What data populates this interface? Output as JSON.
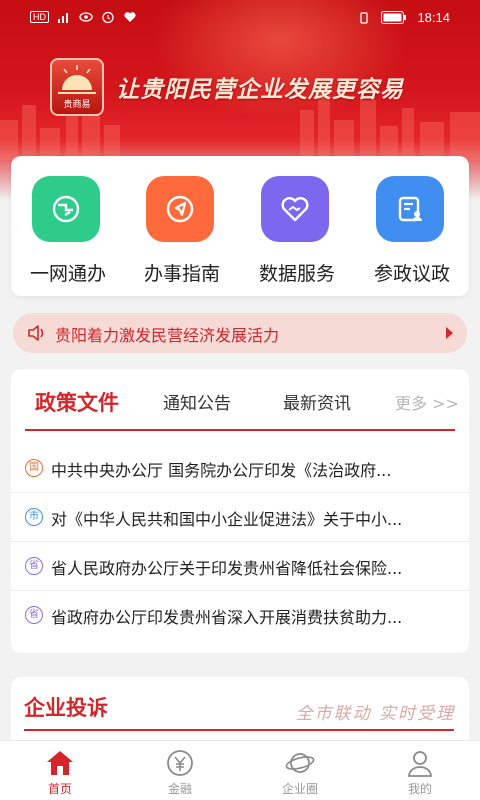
{
  "status_bar": {
    "time": "18:14",
    "left_label": "HD"
  },
  "brand": {
    "logo_text": "贵商易",
    "slogan": "让贵阳民营企业发展更容易"
  },
  "services": [
    {
      "label": "一网通办",
      "icon": "globe-icon",
      "color": "#2dcc8a"
    },
    {
      "label": "办事指南",
      "icon": "compass-icon",
      "color": "#ff6a3c"
    },
    {
      "label": "数据服务",
      "icon": "heart-handshake-icon",
      "color": "#7b68ee"
    },
    {
      "label": "参政议政",
      "icon": "clipboard-person-icon",
      "color": "#3f8ef0"
    }
  ],
  "notice": {
    "text": "贵阳着力激发民营经济发展活力"
  },
  "news": {
    "tabs": [
      "政策文件",
      "通知公告",
      "最新资讯"
    ],
    "more": "更多 >>",
    "items": [
      {
        "badge": "国",
        "badge_color": "#e8703a",
        "title": "中共中央办公厅 国务院办公厅印发《法治政府..."
      },
      {
        "badge": "市",
        "badge_color": "#3f8ef0",
        "title": "对《中华人民共和国中小企业促进法》关于中小..."
      },
      {
        "badge": "省",
        "badge_color": "#8b6fe0",
        "title": "省人民政府办公厅关于印发贵州省降低社会保险..."
      },
      {
        "badge": "省",
        "badge_color": "#8b6fe0",
        "title": "省政府办公厅印发贵州省深入开展消费扶贫助力..."
      }
    ]
  },
  "complaint": {
    "title": "企业投诉",
    "motto": "全市联动 实时受理"
  },
  "bottom_nav": [
    {
      "label": "首页",
      "icon": "home-icon",
      "active": true
    },
    {
      "label": "金融",
      "icon": "yuan-icon",
      "active": false
    },
    {
      "label": "企业圈",
      "icon": "planet-icon",
      "active": false
    },
    {
      "label": "我的",
      "icon": "user-icon",
      "active": false
    }
  ]
}
